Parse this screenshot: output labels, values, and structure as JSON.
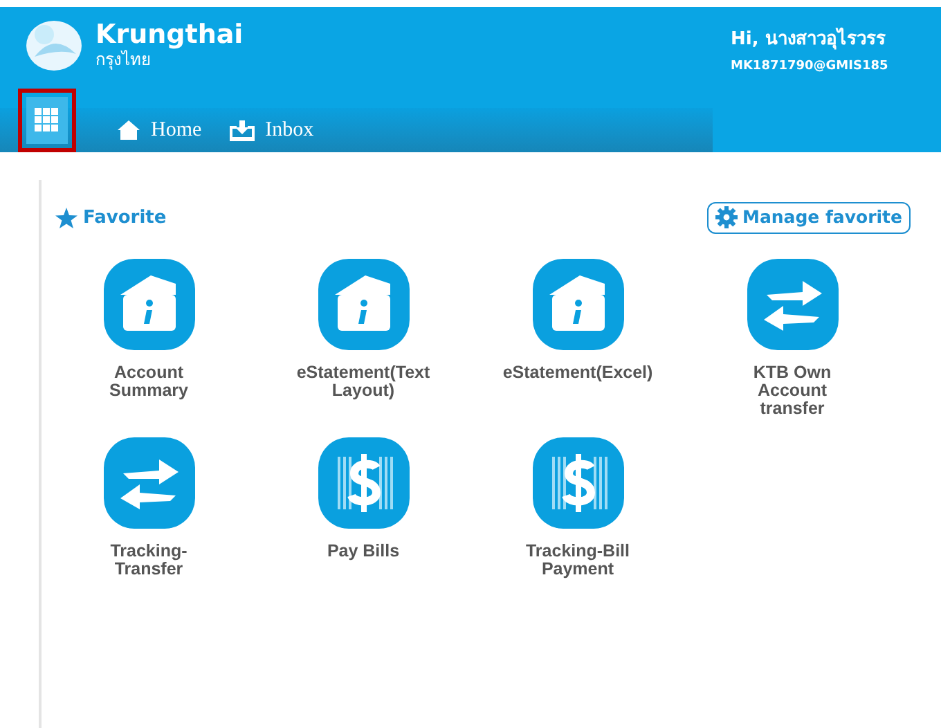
{
  "header": {
    "logo_text": "Krungthai",
    "logo_subtext": "กรุงไทย",
    "greeting": "Hi, นางสาวอุไรวรร",
    "user_id": "MK1871790@GMIS185"
  },
  "nav": {
    "menu_button": {
      "highlighted": true
    },
    "items": [
      {
        "label": "Home",
        "kind": "home",
        "selected": false
      },
      {
        "label": "Inbox",
        "kind": "inbox",
        "selected": false
      }
    ]
  },
  "favorite": {
    "title": "Favorite",
    "manage_button": "Manage favorite",
    "items": [
      {
        "label": "Account Summary",
        "kind": "info"
      },
      {
        "label": "eStatement(Text Layout)",
        "kind": "info"
      },
      {
        "label": "eStatement(Excel)",
        "kind": "info"
      },
      {
        "label": "KTB Own Account transfer",
        "kind": "transfer"
      },
      {
        "label": "Tracking-Transfer",
        "kind": "transfer"
      },
      {
        "label": "Pay Bills",
        "kind": "bill"
      },
      {
        "label": "Tracking-Bill Payment",
        "kind": "bill"
      }
    ]
  }
}
